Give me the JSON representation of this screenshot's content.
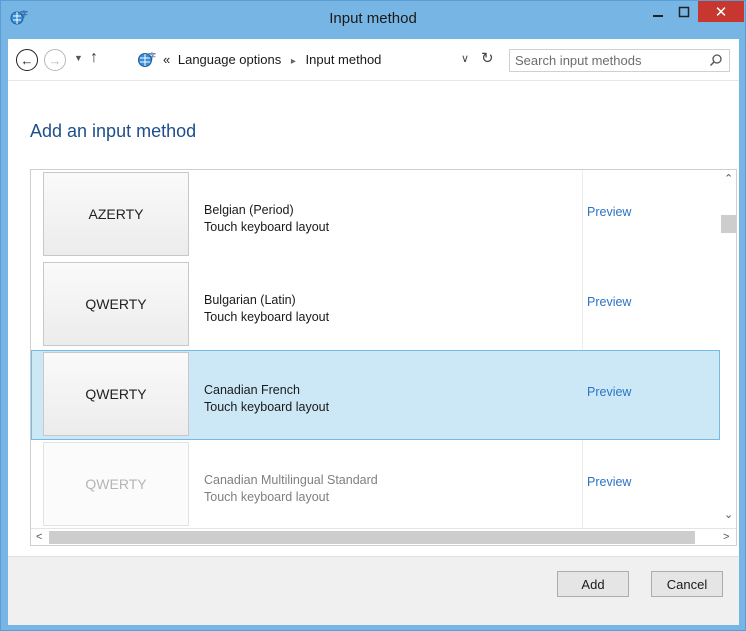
{
  "window": {
    "title": "Input method",
    "close_glyph": "✕"
  },
  "address": {
    "prefix": "«",
    "crumbs": [
      "Language options",
      "Input method"
    ],
    "separator": "▸"
  },
  "search": {
    "placeholder": "Search input methods"
  },
  "heading": "Add an input method",
  "rows": [
    {
      "keyboard": "AZERTY",
      "name": "Belgian (Period)",
      "type": "Touch keyboard layout",
      "action": "Preview",
      "selected": false,
      "faded": false
    },
    {
      "keyboard": "QWERTY",
      "name": "Bulgarian (Latin)",
      "type": "Touch keyboard layout",
      "action": "Preview",
      "selected": false,
      "faded": false
    },
    {
      "keyboard": "QWERTY",
      "name": "Canadian French",
      "type": "Touch keyboard layout",
      "action": "Preview",
      "selected": true,
      "faded": false
    },
    {
      "keyboard": "QWERTY",
      "name": "Canadian Multilingual Standard",
      "type": "Touch keyboard layout",
      "action": "Preview",
      "selected": false,
      "faded": true
    }
  ],
  "buttons": {
    "add": "Add",
    "cancel": "Cancel"
  },
  "colors": {
    "accent_link": "#2b74c4",
    "selected_row": "#cce8f6",
    "heading": "#1e4e8c",
    "close": "#c7372f"
  }
}
